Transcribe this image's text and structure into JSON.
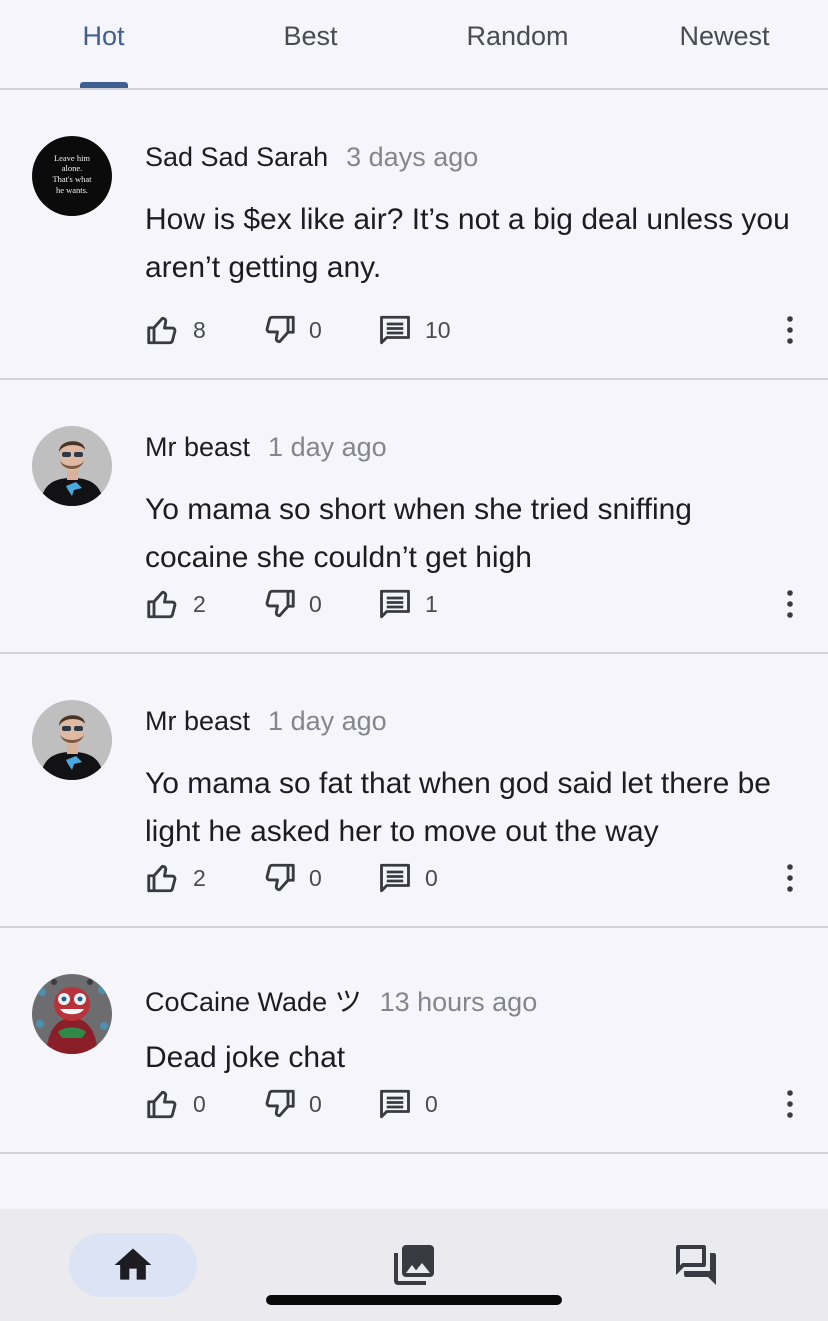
{
  "tabs": [
    {
      "label": "Hot",
      "active": true
    },
    {
      "label": "Best",
      "active": false
    },
    {
      "label": "Random",
      "active": false
    },
    {
      "label": "Newest",
      "active": false
    }
  ],
  "posts": [
    {
      "author": "Sad Sad Sarah",
      "time": "3 days ago",
      "text": "How is $ex like air? It’s not a big deal unless you aren’t getting any.",
      "likes": "8",
      "dislikes": "0",
      "comments": "10",
      "avatar_text": "Leave him alone. That's what he wants."
    },
    {
      "author": "Mr beast",
      "time": "1 day ago",
      "text": "Yo mama so short when she tried sniffing cocaine she couldn’t get high",
      "likes": "2",
      "dislikes": "0",
      "comments": "1"
    },
    {
      "author": "Mr beast",
      "time": "1 day ago",
      "text": "Yo mama so fat that when god said let there be light he asked her to move out the way",
      "likes": "2",
      "dislikes": "0",
      "comments": "0"
    },
    {
      "author": "CoCaine Wade ツ",
      "time": "13 hours ago",
      "text": "Dead joke chat",
      "likes": "0",
      "dislikes": "0",
      "comments": "0"
    }
  ],
  "bottom_nav": {
    "items": [
      {
        "icon": "home-icon",
        "active": true
      },
      {
        "icon": "gallery-icon",
        "active": false
      },
      {
        "icon": "chat-icon",
        "active": false
      }
    ]
  },
  "colors": {
    "accent": "#3e5f91",
    "background": "#f5f5fb",
    "active_nav_pill": "#dce3f4"
  }
}
